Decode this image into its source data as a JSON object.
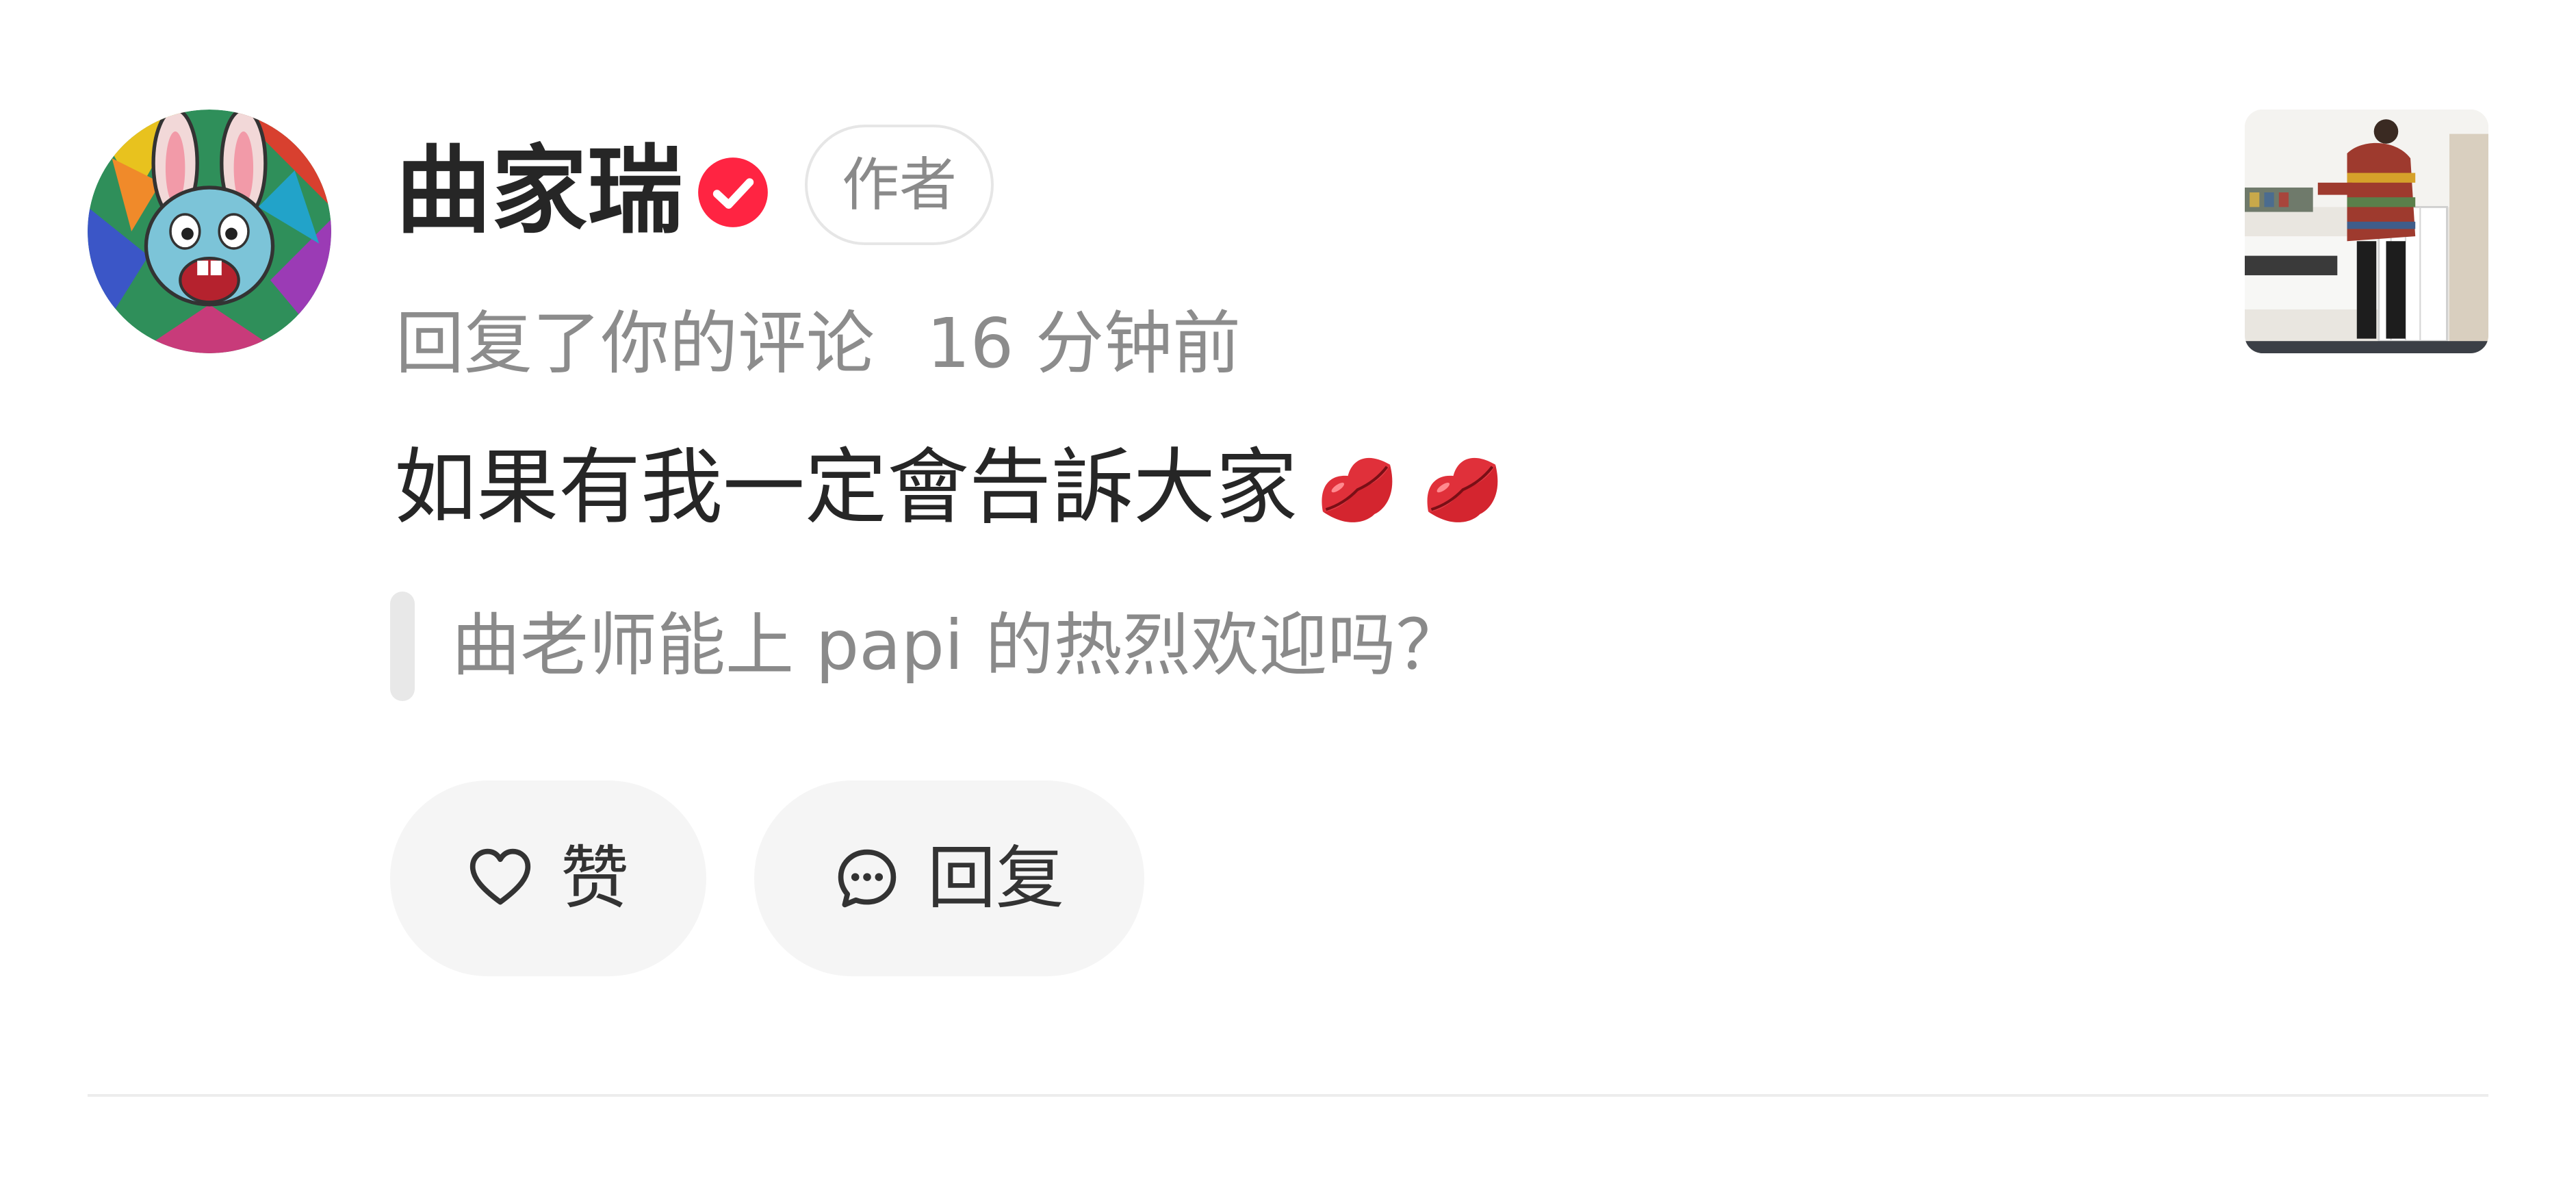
{
  "notification": {
    "author": {
      "name": "曲家瑞",
      "verified_icon": "verified-check-icon",
      "badge_label": "作者"
    },
    "meta": {
      "action_text": "回复了你的评论",
      "time_ago": "16 分钟前"
    },
    "reply_text": "如果有我一定會告訴大家",
    "reply_emoji": [
      "kiss-mark-emoji",
      "kiss-mark-emoji"
    ],
    "quoted_comment": "曲老师能上 papi 的热烈欢迎吗？",
    "actions": {
      "like_label": "赞",
      "like_icon": "heart-outline-icon",
      "reply_label": "回复",
      "reply_icon": "chat-bubble-icon"
    }
  },
  "colors": {
    "verified_red": "#ff2442",
    "lips_red": "#e0303a",
    "text_primary": "#262626",
    "text_secondary": "#8c8c8c",
    "button_bg": "#f5f5f5",
    "divider": "#ededed"
  }
}
